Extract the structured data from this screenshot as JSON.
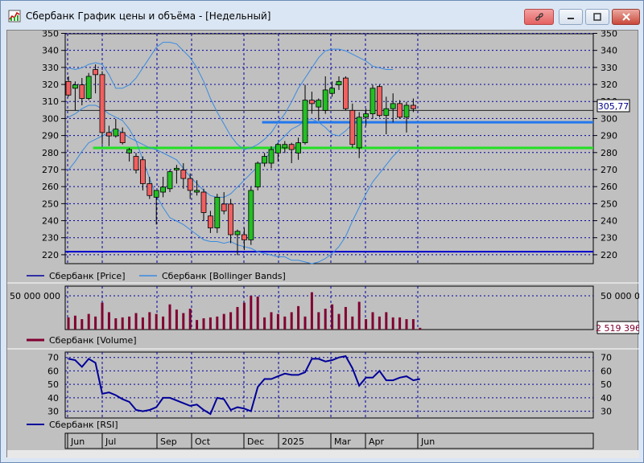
{
  "window": {
    "title": "Сбербанк График цены и объёма - [Недельный]"
  },
  "colors": {
    "panel_bg": "#c0c0c0",
    "grid": "#0000a0",
    "bull_candle": "#22c022",
    "bear_candle": "#f06060",
    "bollinger": "#3a8be0",
    "volume": "#800030",
    "rsi": "#00009a",
    "level_green": "#22e022",
    "level_blue_light": "#2277ee",
    "level_blue_dark": "#0000cc"
  },
  "price_panel": {
    "y_ticks": [
      "350",
      "340",
      "330",
      "320",
      "310",
      "300",
      "290",
      "280",
      "270",
      "260",
      "250",
      "240",
      "230",
      "220"
    ],
    "last_price_label": "305,77",
    "legend": [
      {
        "name": "Сбербанк [Price]",
        "icon": "line-dark-blue"
      },
      {
        "name": "Сбербанк [Bollinger Bands]",
        "icon": "line-light-blue"
      }
    ]
  },
  "volume_panel": {
    "y_tick": "50 000 000",
    "last_volume_label": "2 519 396",
    "legend": [
      {
        "name": "Сбербанк [Volume]",
        "icon": "line-maroon"
      }
    ]
  },
  "rsi_panel": {
    "y_ticks": [
      "70",
      "60",
      "50",
      "40",
      "30"
    ],
    "legend": [
      {
        "name": "Сбербанк [RSI]",
        "icon": "line-navy"
      }
    ]
  },
  "time_axis": {
    "labels": [
      "Jun",
      "Jul",
      "Sep",
      "Oct",
      "Dec",
      "2025",
      "Mar",
      "Apr",
      "Jun"
    ]
  },
  "chart_data": {
    "type": "candlestick",
    "y_range": [
      215,
      350
    ],
    "candles": [
      {
        "o": 322,
        "h": 325,
        "l": 313,
        "c": 314
      },
      {
        "o": 318,
        "h": 322,
        "l": 305,
        "c": 320
      },
      {
        "o": 320,
        "h": 324,
        "l": 308,
        "c": 312
      },
      {
        "o": 312,
        "h": 327,
        "l": 311,
        "c": 325
      },
      {
        "o": 329,
        "h": 332,
        "l": 315,
        "c": 326
      },
      {
        "o": 326,
        "h": 328,
        "l": 285,
        "c": 292
      },
      {
        "o": 292,
        "h": 296,
        "l": 284,
        "c": 290
      },
      {
        "o": 290,
        "h": 300,
        "l": 289,
        "c": 294
      },
      {
        "o": 292,
        "h": 295,
        "l": 285,
        "c": 286
      },
      {
        "o": 280,
        "h": 283,
        "l": 275,
        "c": 282
      },
      {
        "o": 278,
        "h": 280,
        "l": 268,
        "c": 270
      },
      {
        "o": 276,
        "h": 278,
        "l": 258,
        "c": 262
      },
      {
        "o": 262,
        "h": 266,
        "l": 253,
        "c": 255
      },
      {
        "o": 254,
        "h": 258,
        "l": 238,
        "c": 258
      },
      {
        "o": 257,
        "h": 266,
        "l": 254,
        "c": 260
      },
      {
        "o": 259,
        "h": 270,
        "l": 257,
        "c": 269
      },
      {
        "o": 270,
        "h": 273,
        "l": 262,
        "c": 271
      },
      {
        "o": 270,
        "h": 274,
        "l": 259,
        "c": 265
      },
      {
        "o": 265,
        "h": 268,
        "l": 253,
        "c": 258
      },
      {
        "o": 257,
        "h": 264,
        "l": 255,
        "c": 258
      },
      {
        "o": 257,
        "h": 259,
        "l": 240,
        "c": 245
      },
      {
        "o": 243,
        "h": 246,
        "l": 233,
        "c": 236
      },
      {
        "o": 236,
        "h": 256,
        "l": 233,
        "c": 254
      },
      {
        "o": 250,
        "h": 257,
        "l": 244,
        "c": 246
      },
      {
        "o": 250,
        "h": 253,
        "l": 227,
        "c": 232
      },
      {
        "o": 232,
        "h": 235,
        "l": 220,
        "c": 234
      },
      {
        "o": 232,
        "h": 236,
        "l": 223,
        "c": 229
      },
      {
        "o": 229,
        "h": 260,
        "l": 226,
        "c": 258
      },
      {
        "o": 260,
        "h": 275,
        "l": 258,
        "c": 274
      },
      {
        "o": 274,
        "h": 280,
        "l": 272,
        "c": 278
      },
      {
        "o": 274,
        "h": 284,
        "l": 271,
        "c": 282
      },
      {
        "o": 280,
        "h": 286,
        "l": 275,
        "c": 285
      },
      {
        "o": 283,
        "h": 287,
        "l": 280,
        "c": 285
      },
      {
        "o": 285,
        "h": 286,
        "l": 274,
        "c": 282
      },
      {
        "o": 280,
        "h": 289,
        "l": 276,
        "c": 286
      },
      {
        "o": 286,
        "h": 320,
        "l": 285,
        "c": 311
      },
      {
        "o": 311,
        "h": 316,
        "l": 303,
        "c": 309
      },
      {
        "o": 307,
        "h": 312,
        "l": 299,
        "c": 311
      },
      {
        "o": 305,
        "h": 325,
        "l": 303,
        "c": 317
      },
      {
        "o": 315,
        "h": 322,
        "l": 313,
        "c": 318
      },
      {
        "o": 320,
        "h": 325,
        "l": 317,
        "c": 322
      },
      {
        "o": 324,
        "h": 325,
        "l": 305,
        "c": 306
      },
      {
        "o": 305,
        "h": 309,
        "l": 283,
        "c": 285
      },
      {
        "o": 283,
        "h": 304,
        "l": 277,
        "c": 301
      },
      {
        "o": 301,
        "h": 306,
        "l": 296,
        "c": 303
      },
      {
        "o": 303,
        "h": 320,
        "l": 300,
        "c": 318
      },
      {
        "o": 319,
        "h": 320,
        "l": 301,
        "c": 302
      },
      {
        "o": 302,
        "h": 313,
        "l": 291,
        "c": 306
      },
      {
        "o": 306,
        "h": 315,
        "l": 298,
        "c": 309
      },
      {
        "o": 309,
        "h": 311,
        "l": 300,
        "c": 301
      },
      {
        "o": 301,
        "h": 310,
        "l": 292,
        "c": 308
      },
      {
        "o": 308,
        "h": 312,
        "l": 304,
        "c": 306
      }
    ],
    "bollinger_upper": [
      330,
      329,
      330,
      332,
      333,
      332,
      326,
      318,
      318,
      320,
      324,
      330,
      336,
      342,
      345,
      345,
      344,
      340,
      336,
      330,
      322,
      312,
      304,
      297,
      290,
      285,
      282,
      283,
      285,
      288,
      292,
      298,
      303,
      310,
      318,
      324,
      330,
      336,
      340,
      341,
      341,
      340,
      338,
      336,
      334,
      331,
      330,
      329,
      329
    ],
    "bollinger_lower": [
      301,
      303,
      306,
      308,
      308,
      306,
      303,
      301,
      299,
      294,
      287,
      276,
      265,
      255,
      248,
      242,
      240,
      238,
      235,
      232,
      229,
      228,
      228,
      227,
      228,
      226,
      225,
      224,
      222,
      221,
      220,
      219,
      219,
      217,
      217,
      216,
      215,
      216,
      218,
      221,
      225,
      231,
      240,
      248,
      256,
      263,
      268,
      273,
      278,
      282
    ],
    "bollinger_middle_left": [
      270,
      275,
      281,
      286,
      288,
      290,
      292,
      294,
      292,
      289,
      287,
      285,
      283,
      282,
      280,
      278,
      276,
      271,
      266,
      262,
      258,
      255,
      254,
      254,
      256,
      260,
      264,
      268,
      272,
      276,
      281,
      286,
      290,
      294,
      296,
      299,
      300,
      298,
      295,
      291,
      290,
      293,
      297,
      300
    ],
    "bollinger_middle_start_index": 0,
    "levels": [
      {
        "value": 305,
        "type": "thin-black",
        "from_index": 0
      },
      {
        "value": 298,
        "type": "blue-light",
        "from_index": 29
      },
      {
        "value": 283,
        "type": "green",
        "from_index": 4
      },
      {
        "value": 222,
        "type": "blue-dark",
        "from_index": 0
      }
    ],
    "volume": [
      28,
      32,
      24,
      36,
      30,
      62,
      40,
      26,
      28,
      30,
      38,
      28,
      40,
      36,
      30,
      58,
      46,
      38,
      48,
      22,
      26,
      28,
      30,
      36,
      40,
      52,
      62,
      78,
      76,
      28,
      40,
      36,
      30,
      40,
      54,
      30,
      86,
      40,
      48,
      58,
      36,
      52,
      30,
      64,
      24,
      40,
      30,
      40,
      28,
      28,
      24,
      24,
      4
    ],
    "volume_max": 100,
    "rsi": [
      69,
      68,
      63,
      69,
      66,
      43,
      44,
      42,
      39,
      37,
      31,
      30,
      31,
      33,
      40,
      40,
      38,
      36,
      34,
      35,
      31,
      28,
      40,
      39,
      31,
      33,
      32,
      30,
      48,
      54,
      54,
      56,
      58,
      57,
      57,
      59,
      69,
      69,
      67,
      68,
      70,
      71,
      62,
      49,
      55,
      55,
      60,
      53,
      53,
      55,
      56,
      53,
      54
    ]
  }
}
